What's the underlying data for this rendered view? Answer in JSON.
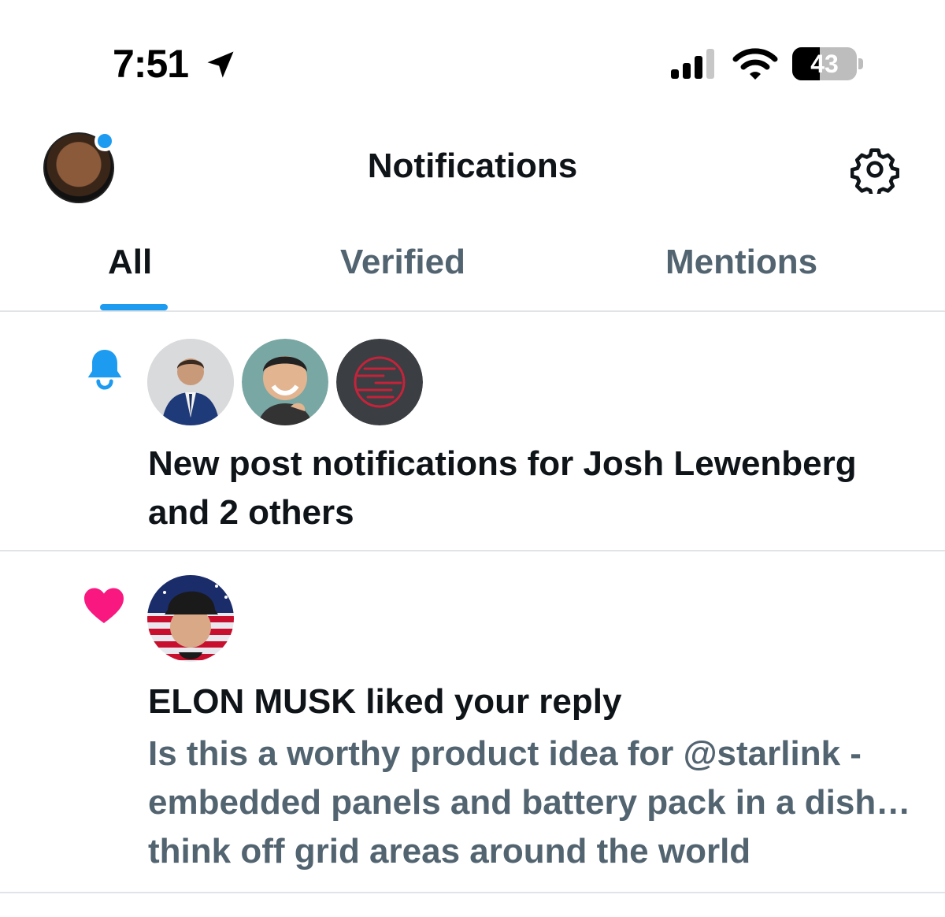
{
  "status_bar": {
    "time": "7:51",
    "battery_level": "43",
    "icons": [
      "location-arrow-icon",
      "cell-signal-icon",
      "wifi-icon",
      "battery-icon"
    ]
  },
  "header": {
    "title": "Notifications",
    "settings_icon": "gear-icon",
    "avatar_has_badge": true
  },
  "tabs": [
    {
      "label": "All",
      "active": true
    },
    {
      "label": "Verified",
      "active": false
    },
    {
      "label": "Mentions",
      "active": false
    }
  ],
  "notifications": [
    {
      "type_icon": "bell-icon",
      "avatars": 3,
      "text": "New post notifications for Josh Lewenberg and 2 others"
    },
    {
      "type_icon": "heart-icon",
      "avatars": 1,
      "text": "ELON MUSK liked your reply",
      "preview": "Is this a worthy product idea for @starlink - embedded panels and battery pack in a dish… think off grid areas around the world"
    }
  ],
  "colors": {
    "accent": "#1d9bf0",
    "like": "#f91880",
    "secondary_text": "#536471",
    "primary_text": "#0f1419"
  }
}
